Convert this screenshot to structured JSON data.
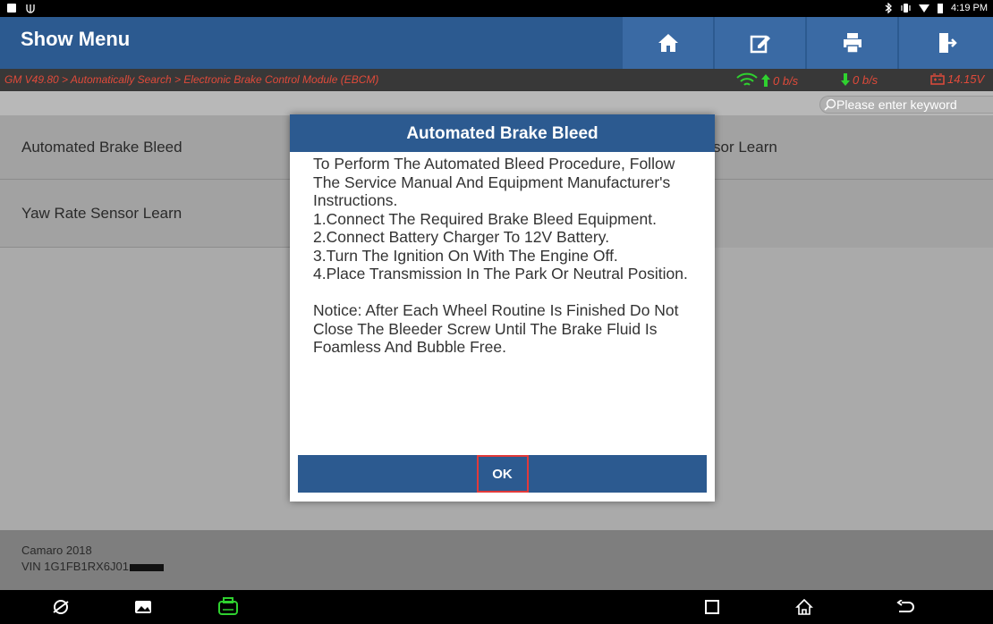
{
  "status_bar": {
    "time": "4:19 PM"
  },
  "header": {
    "title": "Show Menu"
  },
  "breadcrumb": {
    "path": "GM V49.80 > Automatically Search > Electronic Brake Control Module (EBCM)",
    "upload_rate": "0 b/s",
    "download_rate": "0 b/s",
    "voltage": "14.15V"
  },
  "search": {
    "placeholder": "Please enter keyword"
  },
  "menu": {
    "items": [
      "Automated Brake Bleed",
      "Yaw Rate Sensor Learn"
    ],
    "right_item_partial": "sor Learn"
  },
  "dialog": {
    "title": "Automated Brake Bleed",
    "body": "To Perform The Automated Bleed Procedure, Follow The Service Manual And Equipment Manufacturer's Instructions.\n1.Connect The Required Brake Bleed Equipment.\n2.Connect Battery Charger To 12V Battery.\n3.Turn The Ignition On With The Engine Off.\n4.Place Transmission In The Park Or Neutral Position.\n\nNotice: After Each Wheel Routine Is Finished Do Not Close The Bleeder Screw Until The Brake Fluid Is Foamless And Bubble Free.",
    "ok_label": "OK"
  },
  "footer": {
    "vehicle": "Camaro 2018",
    "vin": "VIN 1G1FB1RX6J01"
  },
  "colors": {
    "header_blue": "#2c5a90",
    "breadcrumb_red": "#e04a3a",
    "wifi_green": "#2fd12f",
    "highlight_red": "#e23a3a"
  },
  "icons": {
    "header": [
      "home-icon",
      "edit-icon",
      "print-icon",
      "exit-icon"
    ],
    "nav": [
      "browser-icon",
      "gallery-icon",
      "vci-icon",
      "recents-icon",
      "home-nav-icon",
      "back-icon"
    ]
  }
}
